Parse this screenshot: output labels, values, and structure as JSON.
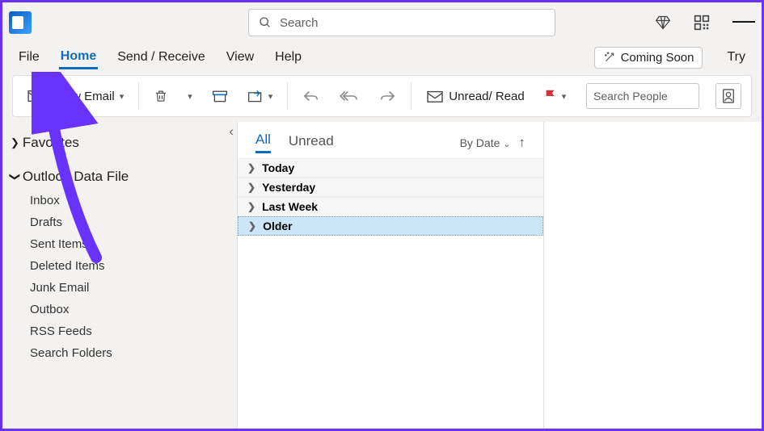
{
  "title": {
    "search_placeholder": "Search"
  },
  "menu": {
    "items": [
      "File",
      "Home",
      "Send / Receive",
      "View",
      "Help"
    ],
    "active_index": 1,
    "coming_soon": "Coming Soon",
    "try": "Try"
  },
  "ribbon": {
    "new_email": "New Email",
    "unread_read": "Unread/ Read",
    "people_search_placeholder": "Search People"
  },
  "nav": {
    "favorites": "Favorites",
    "data_file": "Outlook Data File",
    "folders": [
      "Inbox",
      "Drafts",
      "Sent Items",
      "Deleted Items",
      "Junk Email",
      "Outbox",
      "RSS Feeds",
      "Search Folders"
    ]
  },
  "list": {
    "tabs": {
      "all": "All",
      "unread": "Unread",
      "active": "all"
    },
    "sort_by": "By Date",
    "groups": [
      {
        "label": "Today",
        "selected": false
      },
      {
        "label": "Yesterday",
        "selected": false
      },
      {
        "label": "Last Week",
        "selected": false
      },
      {
        "label": "Older",
        "selected": true
      }
    ]
  },
  "annotation": {
    "arrow_color": "#6933ff"
  }
}
